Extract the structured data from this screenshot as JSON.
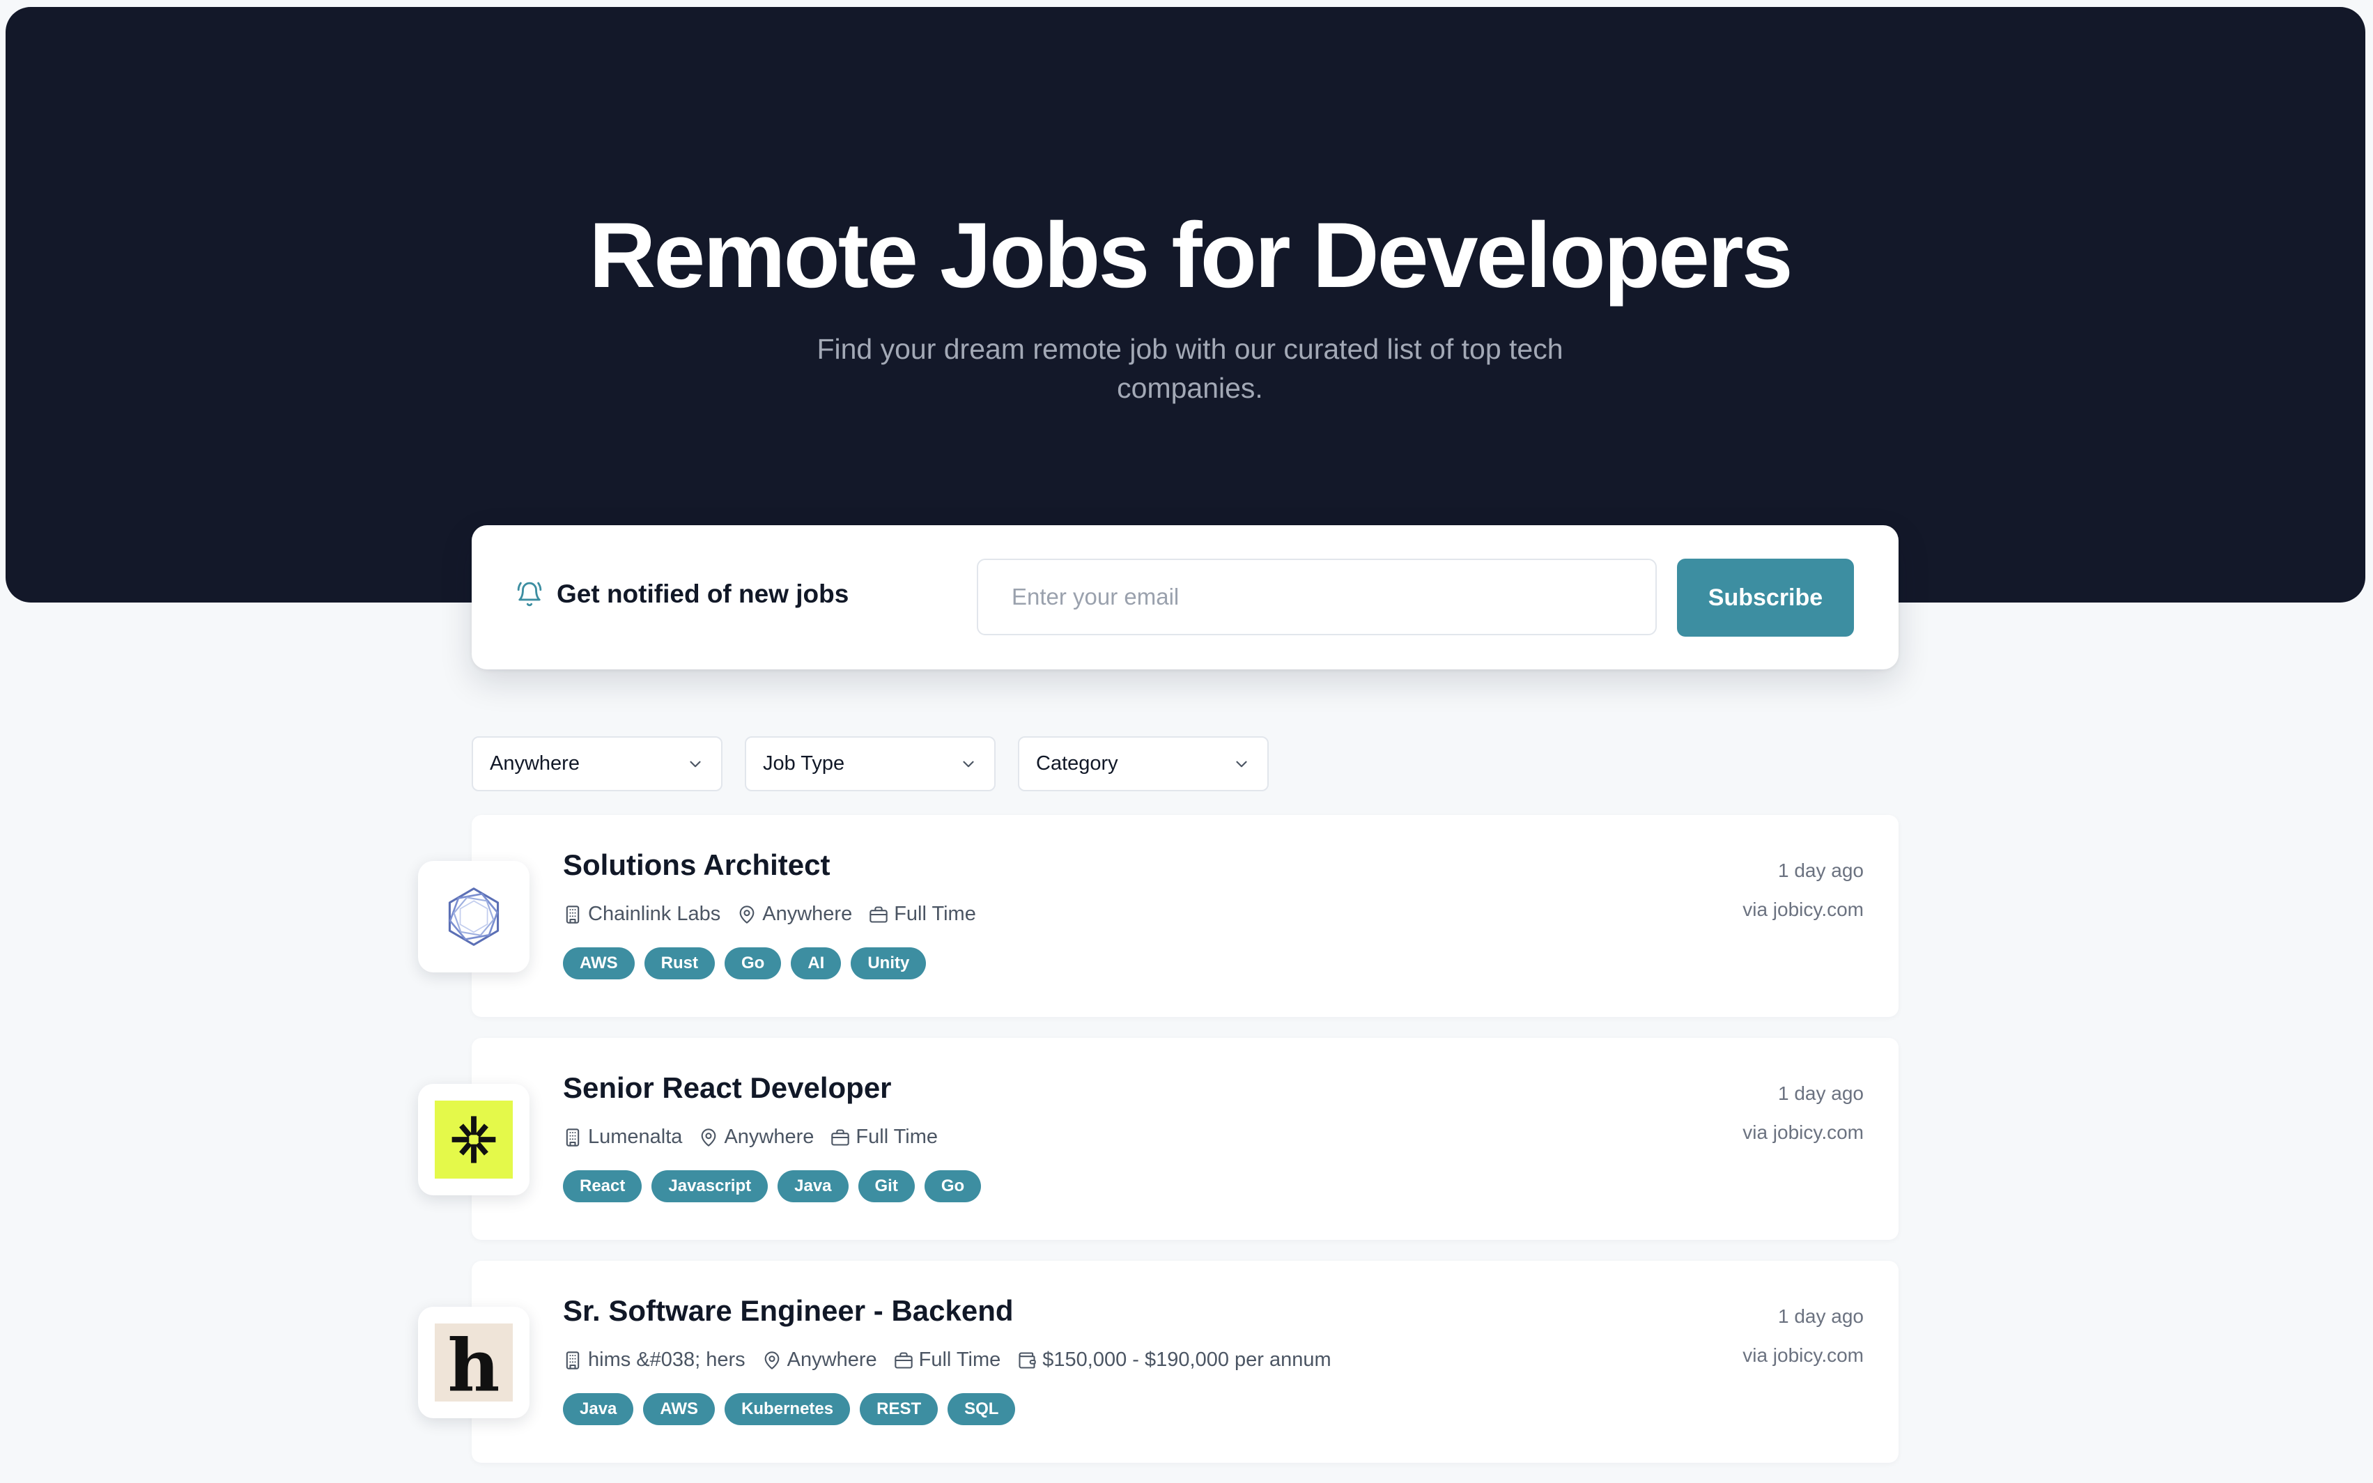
{
  "hero": {
    "title": "Remote Jobs for Developers",
    "subtitle_line1": "Find your dream remote job with our curated list of top tech",
    "subtitle_line2": "companies."
  },
  "notify": {
    "icon": "bell-icon",
    "label": "Get notified of new jobs",
    "email_placeholder": "Enter your email",
    "email_value": "",
    "subscribe_label": "Subscribe"
  },
  "filters": [
    {
      "label": "Anywhere"
    },
    {
      "label": "Job Type"
    },
    {
      "label": "Category"
    }
  ],
  "jobs": [
    {
      "title": "Solutions Architect",
      "company": "Chainlink Labs",
      "location": "Anywhere",
      "type": "Full Time",
      "salary": "",
      "tags": [
        "AWS",
        "Rust",
        "Go",
        "AI",
        "Unity"
      ],
      "posted": "1 day ago",
      "source": "via jobicy.com",
      "logo": "chainlink-logo"
    },
    {
      "title": "Senior React Developer",
      "company": "Lumenalta",
      "location": "Anywhere",
      "type": "Full Time",
      "salary": "",
      "tags": [
        "React",
        "Javascript",
        "Java",
        "Git",
        "Go"
      ],
      "posted": "1 day ago",
      "source": "via jobicy.com",
      "logo": "lumenalta-logo"
    },
    {
      "title": "Sr. Software Engineer - Backend",
      "company": "hims &#038; hers",
      "location": "Anywhere",
      "type": "Full Time",
      "salary": "$150,000 - $190,000 per annum",
      "tags": [
        "Java",
        "AWS",
        "Kubernetes",
        "REST",
        "SQL"
      ],
      "posted": "1 day ago",
      "source": "via jobicy.com",
      "logo": "hims-logo",
      "logo_letter": "h"
    }
  ],
  "colors": {
    "hero_bg": "#131829",
    "accent": "#3d8ea1",
    "page_bg": "#f6f8fa",
    "lumenalta_yellow": "#e4f94a",
    "hims_bg": "#efe4d8"
  }
}
